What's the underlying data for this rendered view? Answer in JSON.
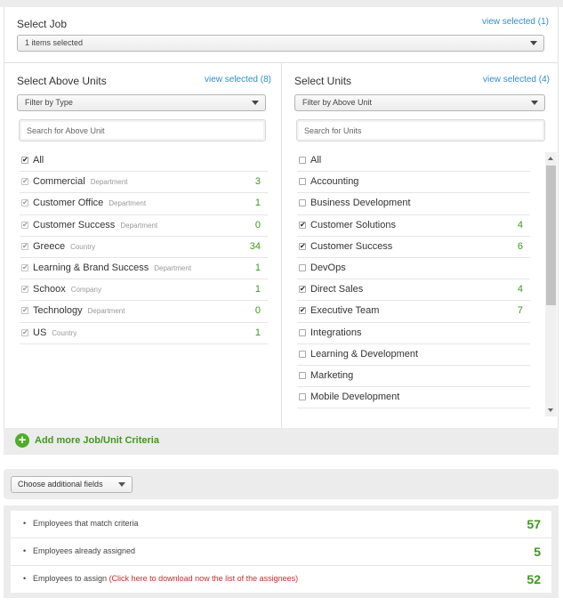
{
  "job": {
    "label": "Select Job",
    "view_selected": "view selected (1)",
    "dropdown_value": "1 items selected"
  },
  "above_units": {
    "label": "Select Above Units",
    "view_selected": "view selected (8)",
    "filter_value": "Filter by Type",
    "search_placeholder": "Search for Above Unit",
    "items": [
      {
        "name": "All",
        "type": "",
        "count": "",
        "checked": true
      },
      {
        "name": "Commercial",
        "type": "Department",
        "count": "3",
        "checked": true
      },
      {
        "name": "Customer Office",
        "type": "Department",
        "count": "1",
        "checked": true
      },
      {
        "name": "Customer Success",
        "type": "Department",
        "count": "0",
        "checked": true
      },
      {
        "name": "Greece",
        "type": "Country",
        "count": "34",
        "checked": true
      },
      {
        "name": "Learning & Brand Success",
        "type": "Department",
        "count": "1",
        "checked": true
      },
      {
        "name": "Schoox",
        "type": "Company",
        "count": "1",
        "checked": true
      },
      {
        "name": "Technology",
        "type": "Department",
        "count": "0",
        "checked": true
      },
      {
        "name": "US",
        "type": "Country",
        "count": "1",
        "checked": true
      }
    ]
  },
  "units": {
    "label": "Select Units",
    "view_selected": "view selected (4)",
    "filter_value": "Filter by Above Unit",
    "search_placeholder": "Search for Units",
    "items": [
      {
        "name": "All",
        "count": "",
        "checked": false
      },
      {
        "name": "Accounting",
        "count": "",
        "checked": false
      },
      {
        "name": "Business Development",
        "count": "",
        "checked": false
      },
      {
        "name": "Customer Solutions",
        "count": "4",
        "checked": true
      },
      {
        "name": "Customer Success",
        "count": "6",
        "checked": true
      },
      {
        "name": "DevOps",
        "count": "",
        "checked": false
      },
      {
        "name": "Direct Sales",
        "count": "4",
        "checked": true
      },
      {
        "name": "Executive Team",
        "count": "7",
        "checked": true
      },
      {
        "name": "Integrations",
        "count": "",
        "checked": false
      },
      {
        "name": "Learning & Development",
        "count": "",
        "checked": false
      },
      {
        "name": "Marketing",
        "count": "",
        "checked": false
      },
      {
        "name": "Mobile Development",
        "count": "",
        "checked": false
      }
    ]
  },
  "add_criteria": {
    "label": "Add more Job/Unit Criteria",
    "icon": "plus-circle-icon"
  },
  "additional_fields": {
    "dropdown_value": "Choose additional fields"
  },
  "summary": {
    "rows": [
      {
        "text": "Employees that match criteria",
        "link": "",
        "value": "57"
      },
      {
        "text": "Employees already assigned",
        "link": "",
        "value": "5"
      },
      {
        "text": "Employees to assign",
        "link": "(Click here to download now the list of the assignees)",
        "value": "52"
      }
    ]
  },
  "colors": {
    "accent_green": "#3a9a1a",
    "link_blue": "#2e8fc9",
    "link_red": "#d12b2b"
  }
}
